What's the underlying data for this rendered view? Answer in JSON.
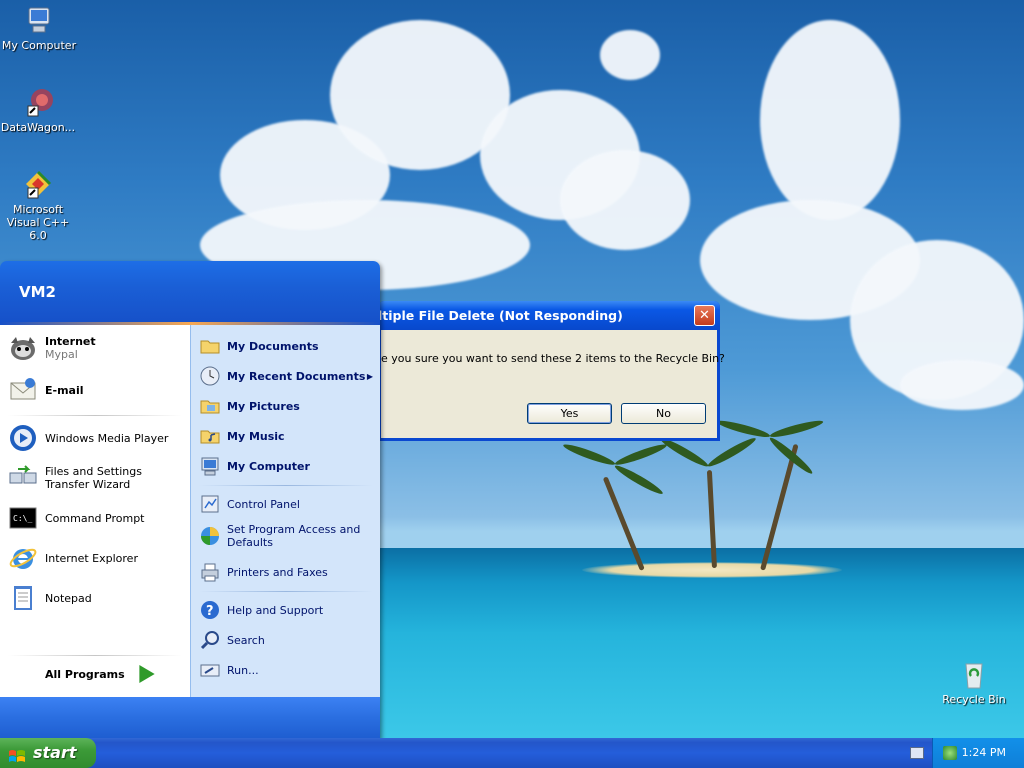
{
  "desktop": {
    "icons": [
      {
        "label": "My Computer",
        "icon": "computer-icon"
      },
      {
        "label": "DataWagon...",
        "icon": "datawagon-shortcut-icon"
      },
      {
        "label": "Microsoft Visual C++ 6.0",
        "icon": "visual-cpp-icon"
      },
      {
        "label": "Recycle Bin",
        "icon": "recycle-bin-icon"
      }
    ]
  },
  "dialog": {
    "title": "ltiple File Delete (Not Responding)",
    "message": "e you sure you want to send these 2 items to the Recycle Bin?",
    "yes_label": "Yes",
    "no_label": "No",
    "close_glyph": "✕"
  },
  "start_menu": {
    "user": "VM2",
    "pinned": [
      {
        "label": "Internet",
        "sub": "Mypal",
        "icon": "mypal-browser-icon"
      },
      {
        "label": "E-mail",
        "icon": "email-icon"
      }
    ],
    "recent": [
      {
        "label": "Windows Media Player",
        "icon": "media-player-icon"
      },
      {
        "label": "Files and Settings Transfer Wizard",
        "icon": "transfer-wizard-icon"
      },
      {
        "label": "Command Prompt",
        "icon": "command-prompt-icon"
      },
      {
        "label": "Internet Explorer",
        "icon": "internet-explorer-icon"
      },
      {
        "label": "Notepad",
        "icon": "notepad-icon"
      }
    ],
    "all_programs": "All Programs",
    "right_items": [
      {
        "label": "My Documents",
        "icon": "folder-icon",
        "bold": true
      },
      {
        "label": "My Recent Documents",
        "icon": "recent-documents-icon",
        "bold": true,
        "submenu": "▶"
      },
      {
        "label": "My Pictures",
        "icon": "pictures-folder-icon",
        "bold": true
      },
      {
        "label": "My Music",
        "icon": "music-folder-icon",
        "bold": true
      },
      {
        "label": "My Computer",
        "icon": "computer-icon",
        "bold": true
      },
      {
        "label": "Control Panel",
        "icon": "control-panel-icon",
        "bold": false
      },
      {
        "label": "Set Program Access and Defaults",
        "icon": "program-access-icon",
        "bold": false
      },
      {
        "label": "Printers and Faxes",
        "icon": "printer-icon",
        "bold": false
      },
      {
        "label": "Help and Support",
        "icon": "help-icon",
        "bold": false
      },
      {
        "label": "Search",
        "icon": "search-icon",
        "bold": false
      },
      {
        "label": "Run...",
        "icon": "run-icon",
        "bold": false
      }
    ]
  },
  "taskbar": {
    "start_label": "start",
    "clock": "1:24 PM"
  },
  "colors": {
    "taskbar": "#245edb",
    "start_button": "#3c9a38",
    "dialog_frame": "#0a48d0",
    "dialog_body": "#ece9d8"
  }
}
